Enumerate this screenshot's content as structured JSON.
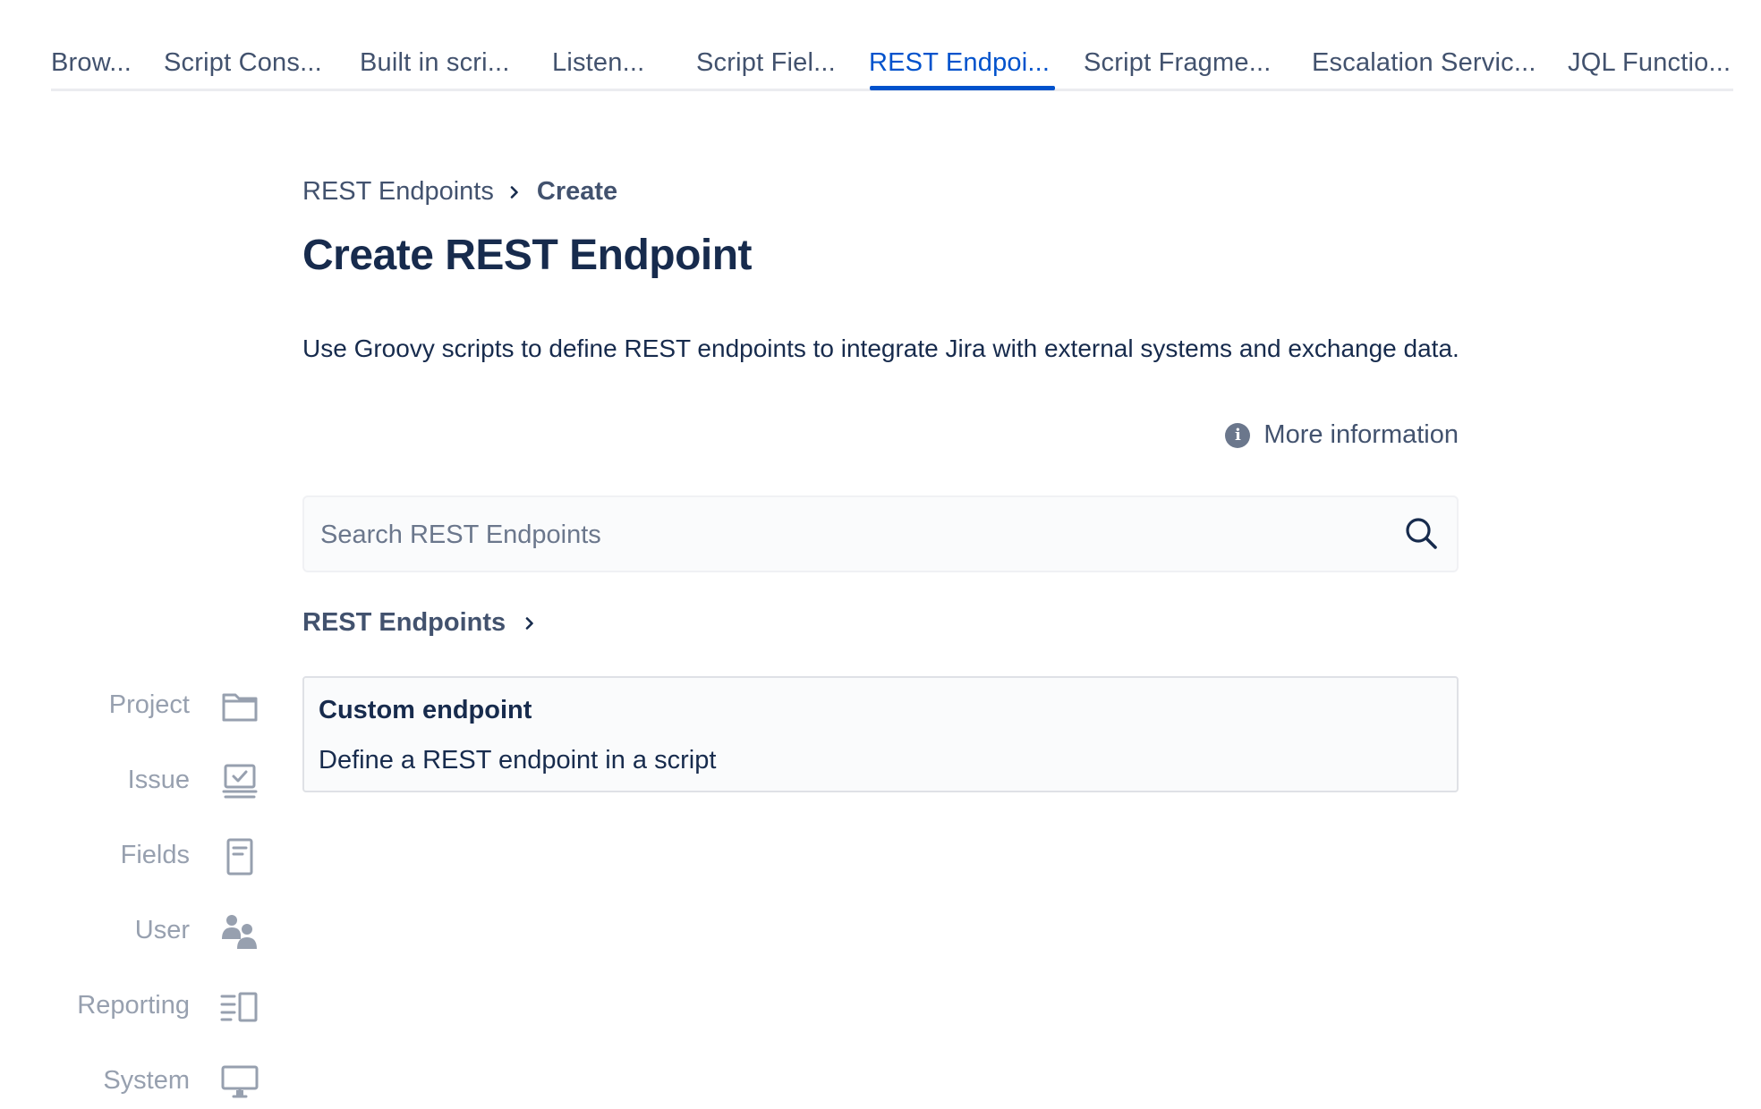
{
  "tabs": [
    {
      "label": "Brow...",
      "active": false
    },
    {
      "label": "Script Cons...",
      "active": false
    },
    {
      "label": "Built in scri...",
      "active": false
    },
    {
      "label": "Listen...",
      "active": false
    },
    {
      "label": "Script Fiel...",
      "active": false
    },
    {
      "label": "REST Endpoi...",
      "active": true
    },
    {
      "label": "Script Fragme...",
      "active": false
    },
    {
      "label": "Escalation Servic...",
      "active": false
    },
    {
      "label": "JQL Functio...",
      "active": false
    }
  ],
  "breadcrumb": {
    "parent": "REST Endpoints",
    "current": "Create"
  },
  "page_title": "Create REST Endpoint",
  "description": "Use Groovy scripts to define REST endpoints to integrate Jira with external systems and exchange data.",
  "more_info": {
    "icon": "info-icon",
    "label": "More information"
  },
  "search": {
    "placeholder": "Search REST Endpoints",
    "value": "",
    "icon": "search-icon"
  },
  "section": {
    "title": "REST Endpoints"
  },
  "cards": [
    {
      "title": "Custom endpoint",
      "description": "Define a REST endpoint in a script"
    }
  ],
  "sidebar": {
    "items": [
      {
        "label": "Project",
        "icon": "folder-icon"
      },
      {
        "label": "Issue",
        "icon": "issue-icon"
      },
      {
        "label": "Fields",
        "icon": "document-icon"
      },
      {
        "label": "User",
        "icon": "users-icon"
      },
      {
        "label": "Reporting",
        "icon": "reporting-icon"
      },
      {
        "label": "System",
        "icon": "monitor-icon"
      }
    ]
  },
  "colors": {
    "accent": "#0052cc",
    "text": "#172b4d",
    "muted": "#42526e",
    "sidebar": "#97a0af"
  }
}
